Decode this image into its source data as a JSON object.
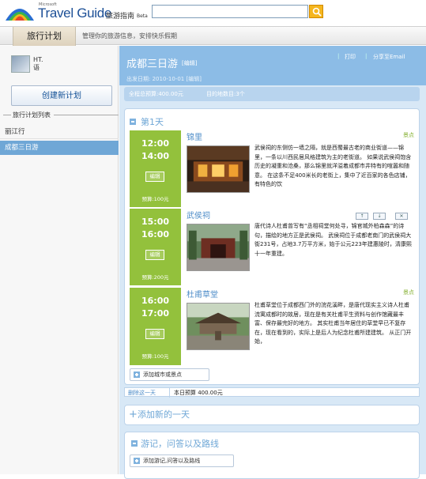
{
  "header": {
    "brand_small": "Microsoft",
    "brand_main": "Travel Guide",
    "brand_cn": "旅游指南",
    "brand_beta": "Beta",
    "search_value": ""
  },
  "nav": {
    "tab_label": "旅行计划",
    "description": "管理你的旅游信息，安排快乐假期"
  },
  "sidebar": {
    "user_name_line1": "HT.",
    "user_name_line2": "语",
    "create_button": "创建新计划",
    "list_heading": "旅行计划列表",
    "plans": [
      "丽江行",
      "成都三日游"
    ]
  },
  "trip": {
    "title": "成都三日游",
    "edit_label": "[编辑]",
    "print_label": "打印",
    "share_label": "分享至Email",
    "depart_date": "出发日期: 2010-10-01 [编辑]",
    "budget_total": "全程总预算:400.00元",
    "spot_count": "目的地数目:3个"
  },
  "day": {
    "heading": "第1天",
    "slots": [
      {
        "start": "12:00",
        "end": "14:00",
        "edit": "编辑",
        "budget": "预算:100元",
        "name": "锦里",
        "tag": "景点",
        "desc": "武侯祠的东侧仿一墙之隔，就是西蜀最古老的商业街道——锦里，一条以川西民居风格建筑为主的老街道。 如果说武侯祠饱含历史的凝重和沧桑，那么锦里就洋溢着成都市井特有的喧嚣和随意。 在这条不足400米长的老街上，集中了近百家的各色店铺，有特色的饮"
      },
      {
        "start": "15:00",
        "end": "16:00",
        "edit": "编辑",
        "budget": "预算:200元",
        "name": "武侯祠",
        "tag": "",
        "desc": "唐代诗人杜甫曾写有“丞相祠堂何处寻，锦官城外柏森森”的诗句，描绘的地方正是武侯祠。 武侯祠位于成都老南门的武侯祠大街231号，占地3.7万平方米，始于公元223年建惠陵时，清康熙十一年重建。"
      },
      {
        "start": "16:00",
        "end": "17:00",
        "edit": "编辑",
        "budget": "预算:100元",
        "name": "杜甫草堂",
        "tag": "景点",
        "desc": "杜甫草堂位于成都西门外的浣花溪畔，是唐代现实主义诗人杜甫流寓成都时的故居，现在是有关杜甫平生资料与创作馆藏最丰富、保存最完好的地方。 其实杜甫当年居住的草堂早已不复存在，现在看到的，实际上是后人为纪念杜甫所建建筑。 从正门开始，"
      }
    ],
    "add_spot": "添加城市或景点",
    "delete_day": "删除这一天",
    "day_budget": "本日预算 400.00元"
  },
  "add_day": "添加新的一天",
  "notes": {
    "heading": "游记，问答以及路线",
    "add_label": "添加游记,问答以及路线"
  },
  "colors": {
    "accent_blue": "#6fa7d6",
    "time_green": "#93c13c",
    "search_orange": "#f5b61e"
  }
}
